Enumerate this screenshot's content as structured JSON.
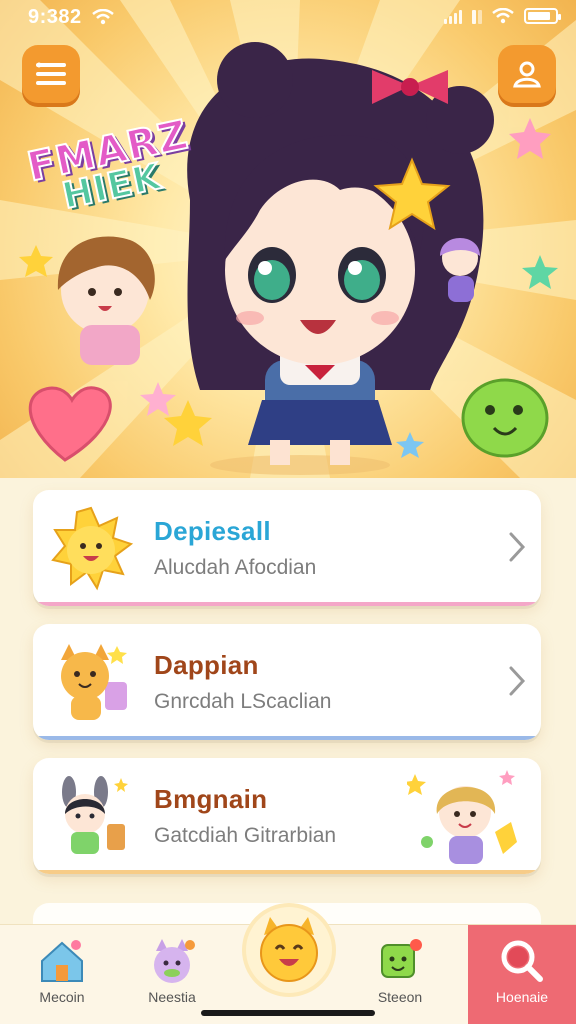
{
  "status_bar": {
    "time": "9:382",
    "battery_level": 0.85
  },
  "header": {
    "logo_line1": "FMARZ",
    "logo_line2": "HIEK"
  },
  "icons": {
    "menu": "menu-icon",
    "profile": "profile-icon",
    "chevron": "chevron-right-icon"
  },
  "cards": [
    {
      "title": "Depiesall",
      "subtitle": "Alucdah Afocdian",
      "title_color": "#2aa6d6",
      "has_chevron": true
    },
    {
      "title": "Dappian",
      "subtitle": "Gnrcdah LScaclian",
      "title_color": "#a0461a",
      "has_chevron": true
    },
    {
      "title": "Bmgnain",
      "subtitle": "Gatcdiah Gitrarbian",
      "title_color": "#a0461a",
      "has_chevron": false
    }
  ],
  "bottom_nav": [
    {
      "label": "Mecoin",
      "icon": "house-icon"
    },
    {
      "label": "Neestia",
      "icon": "cat-face-icon"
    },
    {
      "label": "",
      "icon": "smiling-cat-icon"
    },
    {
      "label": "Steeon",
      "icon": "green-block-icon"
    },
    {
      "label": "Hoenaie",
      "icon": "search-icon"
    }
  ],
  "colors": {
    "accent_orange": "#f39a2f",
    "search_tab": "#ee6a73",
    "background": "#fbf3dc"
  }
}
